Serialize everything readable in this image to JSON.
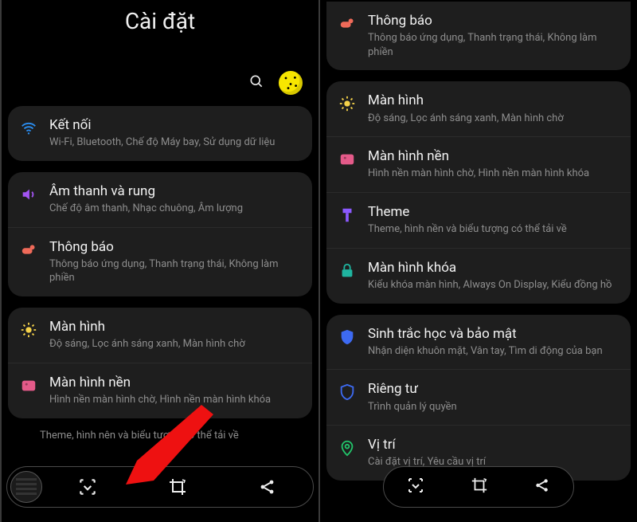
{
  "header": {
    "title": "Cài đặt"
  },
  "left": {
    "groups": [
      {
        "items": [
          {
            "icon": "wifi-icon",
            "color": "c-blue",
            "title": "Kết nối",
            "sub": "Wi-Fi, Bluetooth, Chế độ Máy bay, Sử dụng dữ liệu"
          }
        ]
      },
      {
        "items": [
          {
            "icon": "speaker-icon",
            "color": "c-purple",
            "title": "Âm thanh và rung",
            "sub": "Chế độ âm thanh, Nhạc chuông, Âm lượng"
          },
          {
            "icon": "bell-icon",
            "color": "c-coral",
            "title": "Thông báo",
            "sub": "Thông báo ứng dụng, Thanh trạng thái, Không làm phiền"
          }
        ]
      },
      {
        "items": [
          {
            "icon": "brightness-icon",
            "color": "c-yellow",
            "title": "Màn hình",
            "sub": "Độ sáng, Lọc ánh sáng xanh, Màn hình chờ"
          },
          {
            "icon": "image-icon",
            "color": "c-pink",
            "title": "Màn hình nền",
            "sub": "Hình nền màn hình chờ, Hình nền màn hình khóa"
          }
        ]
      }
    ],
    "bottom_peek": "Theme, hình nên và biểu tượng có thể tải về"
  },
  "right": {
    "groups": [
      {
        "items": [
          {
            "icon": "bell-icon",
            "color": "c-coral",
            "title": "Thông báo",
            "sub": "Thông báo ứng dụng, Thanh trạng thái, Không làm phiền"
          }
        ]
      },
      {
        "items": [
          {
            "icon": "brightness-icon",
            "color": "c-yellow",
            "title": "Màn hình",
            "sub": "Độ sáng, Lọc ánh sáng xanh, Màn hình chờ"
          },
          {
            "icon": "image-icon",
            "color": "c-pink",
            "title": "Màn hình nền",
            "sub": "Hình nền màn hình chờ, Hình nền màn hình khóa"
          },
          {
            "icon": "theme-icon",
            "color": "c-violet",
            "title": "Theme",
            "sub": "Theme, hình nền và biểu tượng có thể tải về"
          },
          {
            "icon": "lock-icon",
            "color": "c-teal",
            "title": "Màn hình khóa",
            "sub": "Kiểu khóa màn hình, Always On Display, Kiểu đồng hồ"
          }
        ]
      },
      {
        "items": [
          {
            "icon": "shield-icon",
            "color": "c-blue2",
            "title": "Sinh trắc học và bảo mật",
            "sub": "Nhận diện khuôn mặt, Vân tay, Tìm di động của bạn"
          },
          {
            "icon": "shield2-icon",
            "color": "c-blue2",
            "title": "Riêng tư",
            "sub": "Trình quản lý quyền"
          },
          {
            "icon": "location-icon",
            "color": "c-gblue",
            "title": "Vị trí",
            "sub": "Cài đặt vị trí, Yêu cầu vị trí"
          }
        ]
      }
    ]
  },
  "toolbar": {
    "scroll_capture": "scroll capture",
    "crop": "crop",
    "share": "share"
  }
}
